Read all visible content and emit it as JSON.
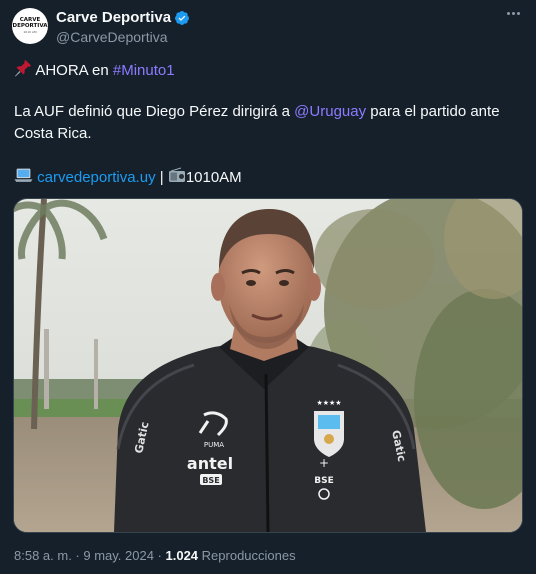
{
  "author": {
    "name": "Carve Deportiva",
    "handle": "@CarveDeportiva",
    "avatar_text_1": "CARVE",
    "avatar_text_2": "DEPORTIVA",
    "avatar_text_3": "1010 AM"
  },
  "body": {
    "line1_text": "AHORA en ",
    "line1_hashtag": "#Minuto1",
    "line2_pre": "La AUF definió que Diego Pérez dirigirá a ",
    "line2_mention": "@Uruguay",
    "line2_post": " para el partido ante",
    "line3": "Costa Rica.",
    "link": "carvedeportiva.uy",
    "separator": " | ",
    "radio": "1010AM"
  },
  "photo": {
    "shirt_sponsor": "antel",
    "shirt_logo": "PUMA",
    "shirt_text": "BSE",
    "sleeve_text": "Gatic"
  },
  "meta": {
    "time": "8:58 a. m. · 9 may. 2024 · ",
    "views": "1.024",
    "views_label": " Reproducciones"
  },
  "colors": {
    "background": "#15202b",
    "link": "#1d9bf0",
    "hashtag": "#8c7bff",
    "muted": "#8b98a5"
  }
}
